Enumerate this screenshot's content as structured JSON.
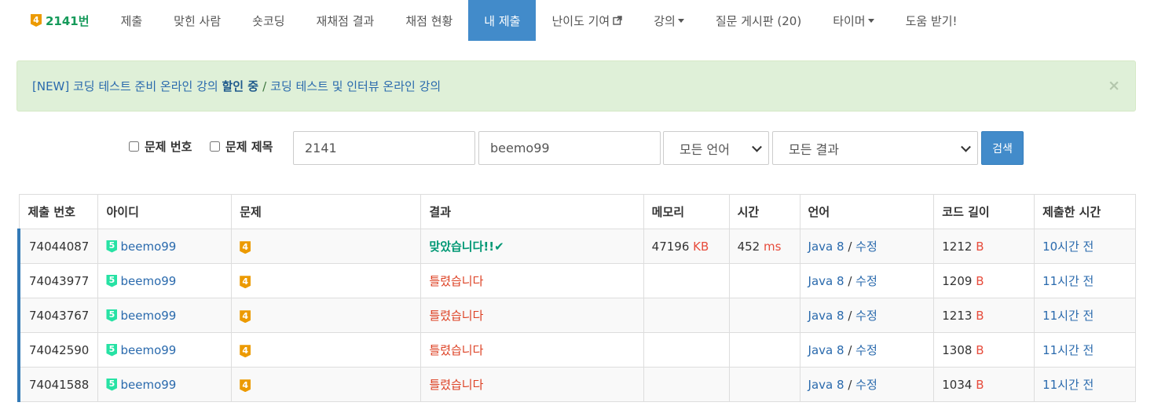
{
  "nav": {
    "brand": {
      "tier": "4",
      "label": "2141번"
    },
    "items": [
      {
        "label": "제출"
      },
      {
        "label": "맞힌 사람"
      },
      {
        "label": "숏코딩"
      },
      {
        "label": "재채점 결과"
      },
      {
        "label": "채점 현황"
      },
      {
        "label": "내 제출",
        "active": true
      },
      {
        "label": "난이도 기여"
      },
      {
        "label": "강의"
      },
      {
        "label": "질문 게시판 (20)"
      },
      {
        "label": "타이머"
      },
      {
        "label": "도움 받기!"
      }
    ]
  },
  "alert": {
    "prefix": "[NEW] 코딩 테스트 준비 온라인 강의",
    "highlight": "할인 중",
    "separator": "/",
    "link2": "코딩 테스트 및 인터뷰 온라인 강의",
    "close": "×"
  },
  "search": {
    "checkbox_problem_number": "문제 번호",
    "checkbox_problem_title": "문제 제목",
    "problem_value": "2141",
    "user_value": "beemo99",
    "language_selected": "모든 언어",
    "result_selected": "모든 결과",
    "button": "검색"
  },
  "table": {
    "headers": [
      "제출 번호",
      "아이디",
      "문제",
      "결과",
      "메모리",
      "시간",
      "언어",
      "코드 길이",
      "제출한 시간"
    ],
    "rows": [
      {
        "id": "74044087",
        "user": "beemo99",
        "user_tier": "5",
        "problem_tier": "4",
        "result": "맞았습니다!!",
        "accepted": true,
        "memory": "47196",
        "memory_unit": "KB",
        "time": "452",
        "time_unit": "ms",
        "lang": "Java 8",
        "edit": "수정",
        "length": "1212",
        "length_unit": "B",
        "submitted": "10시간 전"
      },
      {
        "id": "74043977",
        "user": "beemo99",
        "user_tier": "5",
        "problem_tier": "4",
        "result": "틀렸습니다",
        "accepted": false,
        "memory": "",
        "memory_unit": "",
        "time": "",
        "time_unit": "",
        "lang": "Java 8",
        "edit": "수정",
        "length": "1209",
        "length_unit": "B",
        "submitted": "11시간 전"
      },
      {
        "id": "74043767",
        "user": "beemo99",
        "user_tier": "5",
        "problem_tier": "4",
        "result": "틀렸습니다",
        "accepted": false,
        "memory": "",
        "memory_unit": "",
        "time": "",
        "time_unit": "",
        "lang": "Java 8",
        "edit": "수정",
        "length": "1213",
        "length_unit": "B",
        "submitted": "11시간 전"
      },
      {
        "id": "74042590",
        "user": "beemo99",
        "user_tier": "5",
        "problem_tier": "4",
        "result": "틀렸습니다",
        "accepted": false,
        "memory": "",
        "memory_unit": "",
        "time": "",
        "time_unit": "",
        "lang": "Java 8",
        "edit": "수정",
        "length": "1308",
        "length_unit": "B",
        "submitted": "11시간 전"
      },
      {
        "id": "74041588",
        "user": "beemo99",
        "user_tier": "5",
        "problem_tier": "4",
        "result": "틀렸습니다",
        "accepted": false,
        "memory": "",
        "memory_unit": "",
        "time": "",
        "time_unit": "",
        "lang": "Java 8",
        "edit": "수정",
        "length": "1034",
        "length_unit": "B",
        "submitted": "11시간 전"
      }
    ]
  },
  "colors": {
    "accent": "#428bca",
    "accepted": "#009874",
    "wrong": "#dd4124",
    "tier_gold": "#ec9a00",
    "tier_platinum": "#27e2a4",
    "alert_bg": "#dff0d8"
  }
}
